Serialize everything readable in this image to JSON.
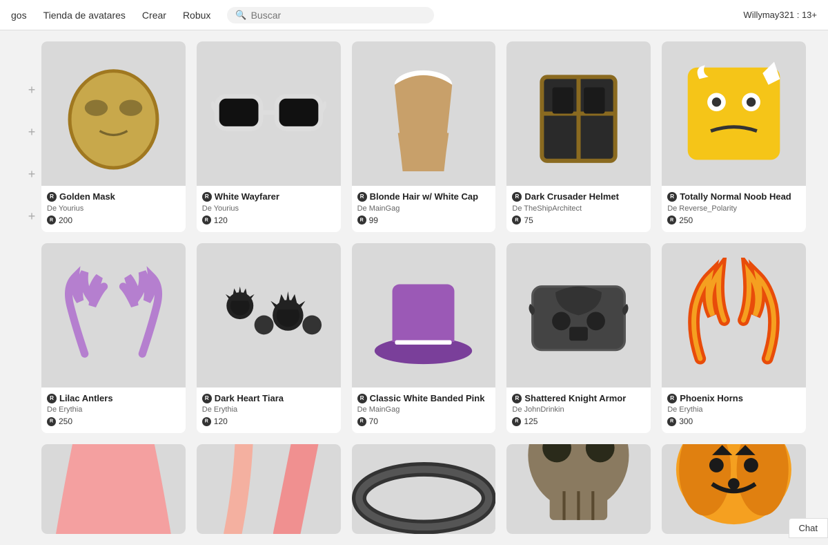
{
  "nav": {
    "items": [
      {
        "label": "gos",
        "id": "nav-gos"
      },
      {
        "label": "Tienda de avatares",
        "id": "nav-tienda"
      },
      {
        "label": "Crear",
        "id": "nav-crear"
      },
      {
        "label": "Robux",
        "id": "nav-robux"
      }
    ],
    "search_placeholder": "Buscar",
    "user": "Willymay321 : 13+"
  },
  "sidebar": {
    "icons": [
      "+",
      "+",
      "+",
      "+"
    ]
  },
  "products": [
    {
      "id": "golden-mask",
      "name": "Golden Mask",
      "creator": "De Yourius",
      "price": "200",
      "color": "#c8a84b",
      "shape": "mask"
    },
    {
      "id": "white-wayfarer",
      "name": "White Wayfarer",
      "creator": "De Yourius",
      "price": "120",
      "color": "#eee",
      "shape": "glasses"
    },
    {
      "id": "blonde-hair",
      "name": "Blonde Hair w/ White Cap",
      "creator": "De MainGag",
      "price": "99",
      "color": "#c8a06a",
      "shape": "hair"
    },
    {
      "id": "dark-crusader",
      "name": "Dark Crusader Helmet",
      "creator": "De TheShipArchitect",
      "price": "75",
      "color": "#333",
      "shape": "helmet"
    },
    {
      "id": "noob-head",
      "name": "Totally Normal Noob Head",
      "creator": "De Reverse_Polarity",
      "price": "250",
      "color": "#f5c518",
      "shape": "noob"
    },
    {
      "id": "lilac-antlers",
      "name": "Lilac Antlers",
      "creator": "De Erythia",
      "price": "250",
      "color": "#b57fcf",
      "shape": "antlers"
    },
    {
      "id": "dark-heart-tiara",
      "name": "Dark Heart Tiara",
      "creator": "De Erythia",
      "price": "120",
      "color": "#444",
      "shape": "tiara"
    },
    {
      "id": "banded-pink",
      "name": "Classic White Banded Pink",
      "creator": "De MainGag",
      "price": "70",
      "color": "#9b59b6",
      "shape": "hat"
    },
    {
      "id": "shattered-knight",
      "name": "Shattered Knight Armor",
      "creator": "De JohnDrinkin",
      "price": "125",
      "color": "#555",
      "shape": "armor"
    },
    {
      "id": "phoenix-horns",
      "name": "Phoenix Horns",
      "creator": "De Erythia",
      "price": "300",
      "color": "#e84c0a",
      "shape": "horns"
    },
    {
      "id": "partial1",
      "name": "",
      "creator": "",
      "price": "",
      "color": "#f4a0a0",
      "shape": "partial-dress"
    },
    {
      "id": "partial2",
      "name": "",
      "creator": "",
      "price": "",
      "color": "#f09090",
      "shape": "partial-hair2"
    },
    {
      "id": "partial3",
      "name": "",
      "creator": "",
      "price": "",
      "color": "#444",
      "shape": "partial-ring"
    },
    {
      "id": "partial4",
      "name": "",
      "creator": "",
      "price": "",
      "color": "#8a7a60",
      "shape": "partial-skull"
    },
    {
      "id": "partial5",
      "name": "",
      "creator": "",
      "price": "",
      "color": "#f5a020",
      "shape": "partial-pumpkin"
    }
  ],
  "chat": {
    "label": "Chat"
  }
}
